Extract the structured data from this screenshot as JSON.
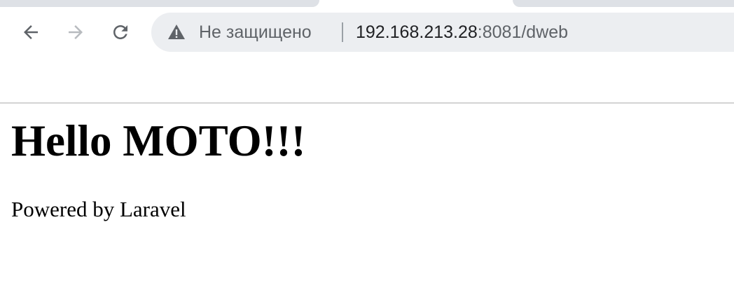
{
  "browser": {
    "security_label": "Не защищено",
    "url_host": "192.168.213.28",
    "url_rest": ":8081/dweb",
    "icons": {
      "back": "arrow-left-icon",
      "forward": "arrow-right-icon",
      "reload": "reload-icon",
      "security": "warning-triangle-icon"
    }
  },
  "page": {
    "heading": "Hello MOTO!!!",
    "footer": "Powered by Laravel"
  }
}
